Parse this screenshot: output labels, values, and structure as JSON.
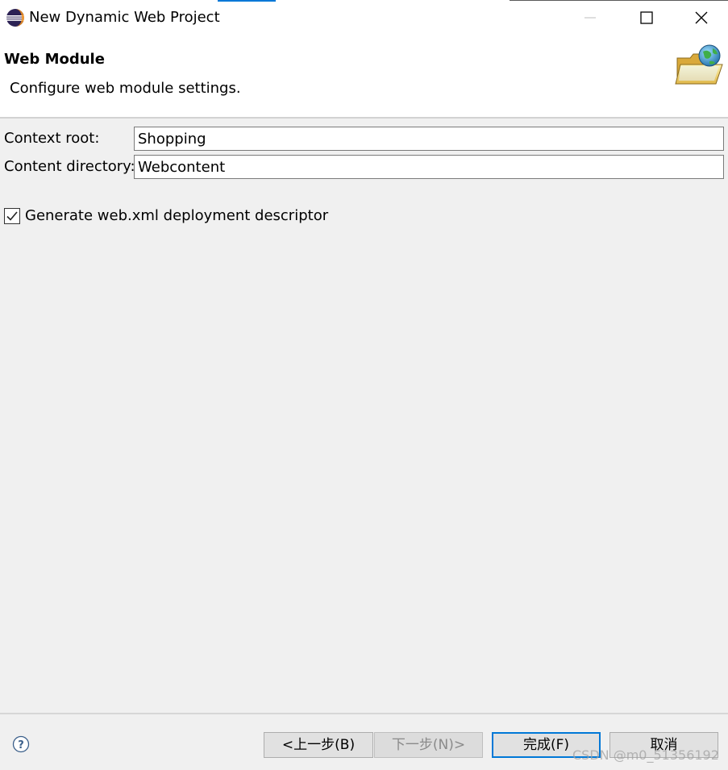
{
  "window": {
    "title": "New Dynamic Web Project",
    "app_icon": "eclipse-icon",
    "controls": [
      "minimize-icon",
      "maximize-icon",
      "close-icon"
    ]
  },
  "header": {
    "title": "Web Module",
    "description": "Configure web module settings.",
    "icon": "web-folder-globe-icon"
  },
  "form": {
    "context_root_label": "Context root:",
    "context_root_value": "Shopping",
    "content_dir_label": "Content directory:",
    "content_dir_value": "Webcontent",
    "generate_label": "Generate web.xml deployment descriptor",
    "generate_checked": true
  },
  "footer": {
    "help_icon": "help-icon",
    "back_label": "<上一步(B)",
    "next_label": "下一步(N)>",
    "finish_label": "完成(F)",
    "cancel_label": "取消"
  },
  "watermark": "CSDN @m0_51356192",
  "colors": {
    "accent": "#0078d7",
    "background": "#f0f0f0",
    "banner": "#ffffff"
  }
}
